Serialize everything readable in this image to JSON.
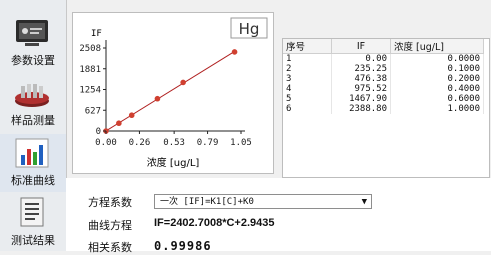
{
  "sidebar": {
    "items": [
      {
        "label": "参数设置",
        "icon": "monitor-icon"
      },
      {
        "label": "样品测量",
        "icon": "sample-tray-icon"
      },
      {
        "label": "标准曲线",
        "icon": "bar-chart-icon"
      },
      {
        "label": "测试结果",
        "icon": "report-icon"
      }
    ],
    "active": "标准曲线"
  },
  "chart_data": {
    "type": "scatter",
    "title": "",
    "element_label": "Hg",
    "ylabel": "IF",
    "xlabel": "浓度 [ug/L]",
    "xlim": [
      0,
      1.05
    ],
    "ylim": [
      0,
      2508
    ],
    "x_ticks": [
      "0.00",
      "0.26",
      "0.53",
      "0.79",
      "1.05"
    ],
    "y_ticks": [
      "2508",
      "1881",
      "1254",
      "627",
      "0"
    ],
    "series": [
      {
        "x": [
          0.0,
          0.1,
          0.2,
          0.4,
          0.6,
          1.0
        ],
        "y": [
          0.0,
          235.25,
          476.38,
          975.52,
          1467.9,
          2388.8
        ]
      }
    ],
    "fit_line": {
      "slope": 2402.7008,
      "intercept": 2.9435
    },
    "colors": {
      "points": "#d04030",
      "line": "#b02020"
    }
  },
  "table": {
    "headers": [
      "序号",
      "IF",
      "浓度 [ug/L]"
    ],
    "rows": [
      [
        "1",
        "0.00",
        "0.0000"
      ],
      [
        "2",
        "235.25",
        "0.1000"
      ],
      [
        "3",
        "476.38",
        "0.2000"
      ],
      [
        "4",
        "975.52",
        "0.4000"
      ],
      [
        "5",
        "1467.90",
        "0.6000"
      ],
      [
        "6",
        "2388.80",
        "1.0000"
      ]
    ]
  },
  "equation": {
    "type_label": "方程系数",
    "type_value": "一次 [IF]=K1[C]+K0",
    "curve_label": "曲线方程",
    "curve_value": "IF=2402.7008*C+2.9435",
    "r_label": "相关系数",
    "r_value": "0.99986"
  }
}
